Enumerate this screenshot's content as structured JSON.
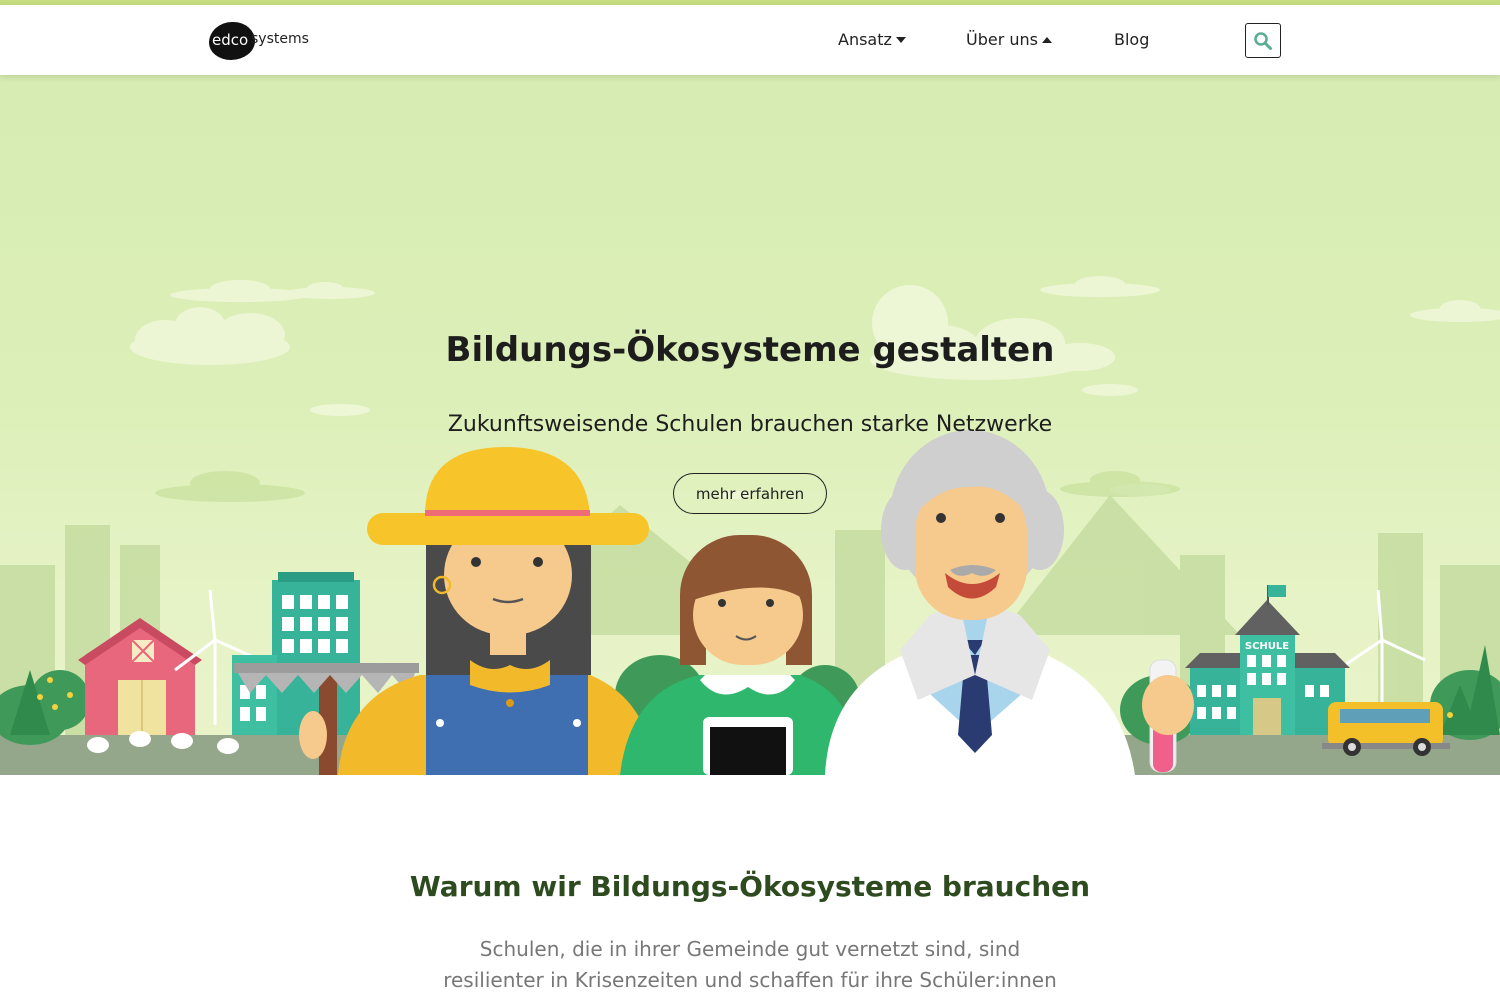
{
  "brand": {
    "logo_part1": "edco",
    "logo_part2": "systems"
  },
  "nav": {
    "items": [
      {
        "label": "Ansatz",
        "caret": "down"
      },
      {
        "label": "Über uns",
        "caret": "up"
      },
      {
        "label": "Blog"
      }
    ],
    "search_icon": "search-icon"
  },
  "hero": {
    "title": "Bildungs-Ökosysteme gestalten",
    "subtitle": "Zukunftsweisende Schulen brauchen starke Netzwerke",
    "button_label": "mehr erfahren",
    "school_sign": "SCHULE"
  },
  "section": {
    "heading": "Warum wir Bildungs-Ökosysteme brauchen",
    "text_line1": "Schulen, die in ihrer Gemeinde gut vernetzt sind, sind",
    "text_line2": "resilienter in Krisenzeiten und schaffen für ihre Schüler:innen"
  },
  "colors": {
    "accent_bar": "#c6dd7e",
    "heading_green": "#2e4a1f",
    "hero_sky": "#d6ecb2"
  }
}
